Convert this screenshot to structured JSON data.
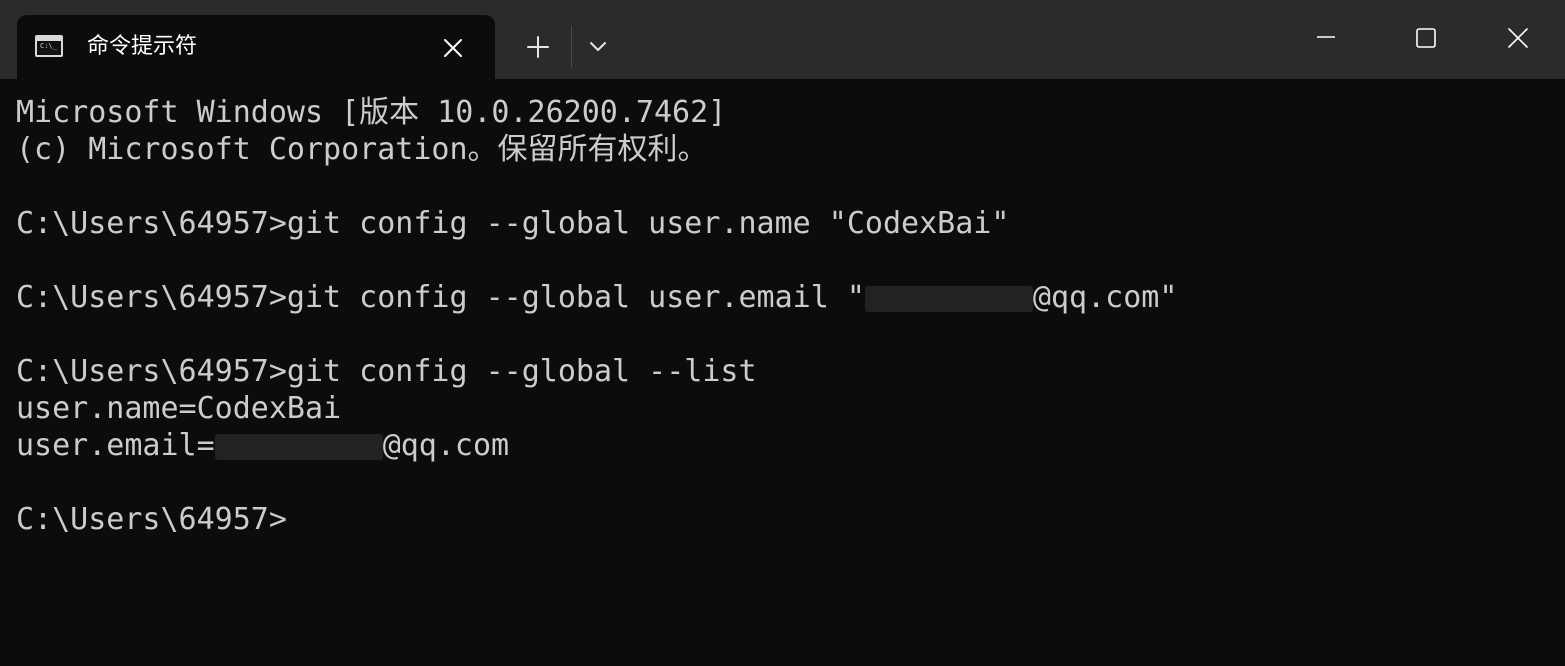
{
  "window": {
    "tab_title": "命令提示符",
    "icon": "command-prompt-icon",
    "tab_icon_prompt": "C:\\_"
  },
  "titlebar_buttons": {
    "tab_close": "close-icon",
    "new_tab": "plus-icon",
    "dropdown": "chevron-down-icon",
    "minimize": "minimize-icon",
    "maximize": "maximize-icon",
    "close": "close-icon"
  },
  "terminal": {
    "line1": "Microsoft Windows [版本 10.0.26200.7462]",
    "line2": "(c) Microsoft Corporation。保留所有权利。",
    "cmd1": "C:\\Users\\64957>git config --global user.name \"CodexBai\"",
    "cmd2_prefix": "C:\\Users\\64957>git config --global user.email \"",
    "cmd2_suffix": "@qq.com\"",
    "cmd3": "C:\\Users\\64957>git config --global --list",
    "out_name": "user.name=CodexBai",
    "out_email_prefix": "user.email=",
    "out_email_suffix": "@qq.com",
    "prompt": "C:\\Users\\64957>"
  },
  "colors": {
    "titlebar_bg": "#2b2b2b",
    "terminal_bg": "#0c0c0c",
    "terminal_fg": "#cccccc"
  }
}
